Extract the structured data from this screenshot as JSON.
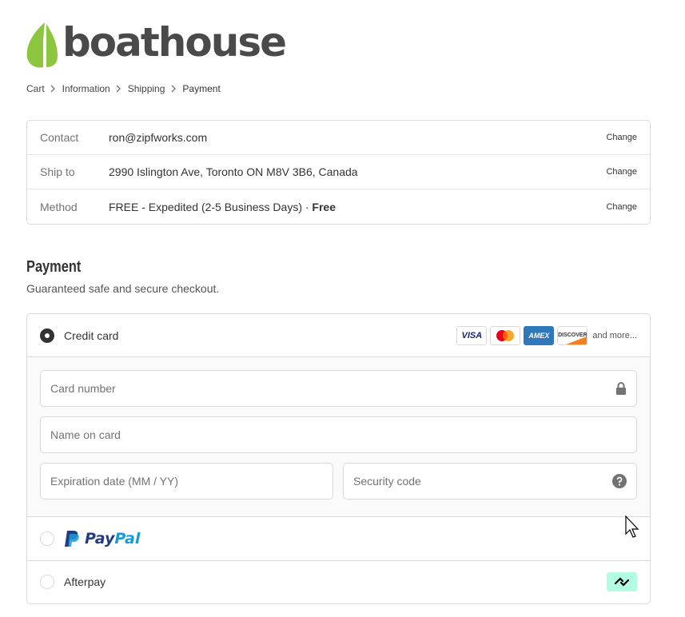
{
  "brand": {
    "name": "boathouse",
    "leaf_color": "#8cc63f",
    "text_color": "#4a4a4a"
  },
  "breadcrumb": [
    {
      "label": "Cart",
      "current": false
    },
    {
      "label": "Information",
      "current": false
    },
    {
      "label": "Shipping",
      "current": false
    },
    {
      "label": "Payment",
      "current": true
    }
  ],
  "review": {
    "contact": {
      "label": "Contact",
      "value": "ron@zipfworks.com",
      "change": "Change"
    },
    "ship_to": {
      "label": "Ship to",
      "value": "2990 Islington Ave, Toronto ON M8V 3B6, Canada",
      "change": "Change"
    },
    "method": {
      "label": "Method",
      "value": "FREE - Expedited (2-5 Business Days) · ",
      "price": "Free",
      "change": "Change"
    }
  },
  "payment": {
    "title": "Payment",
    "subtitle": "Guaranteed safe and secure checkout.",
    "credit_card": {
      "label": "Credit card",
      "selected": true,
      "card_brands": [
        "VISA",
        "Mastercard",
        "AMEX",
        "DISCOVER"
      ],
      "more": "and more...",
      "fields": {
        "card_number": {
          "placeholder": "Card number",
          "icon": "lock-icon"
        },
        "name_on_card": {
          "placeholder": "Name on card"
        },
        "expiration": {
          "placeholder": "Expiration date (MM / YY)"
        },
        "security_code": {
          "placeholder": "Security code",
          "icon": "help-icon"
        }
      }
    },
    "paypal": {
      "label_pay": "Pay",
      "label_pal": "Pal",
      "selected": false,
      "colors": {
        "dark": "#253b80",
        "light": "#179bd7"
      }
    },
    "afterpay": {
      "label": "Afterpay",
      "selected": false,
      "badge_color": "#b2fce4"
    }
  }
}
